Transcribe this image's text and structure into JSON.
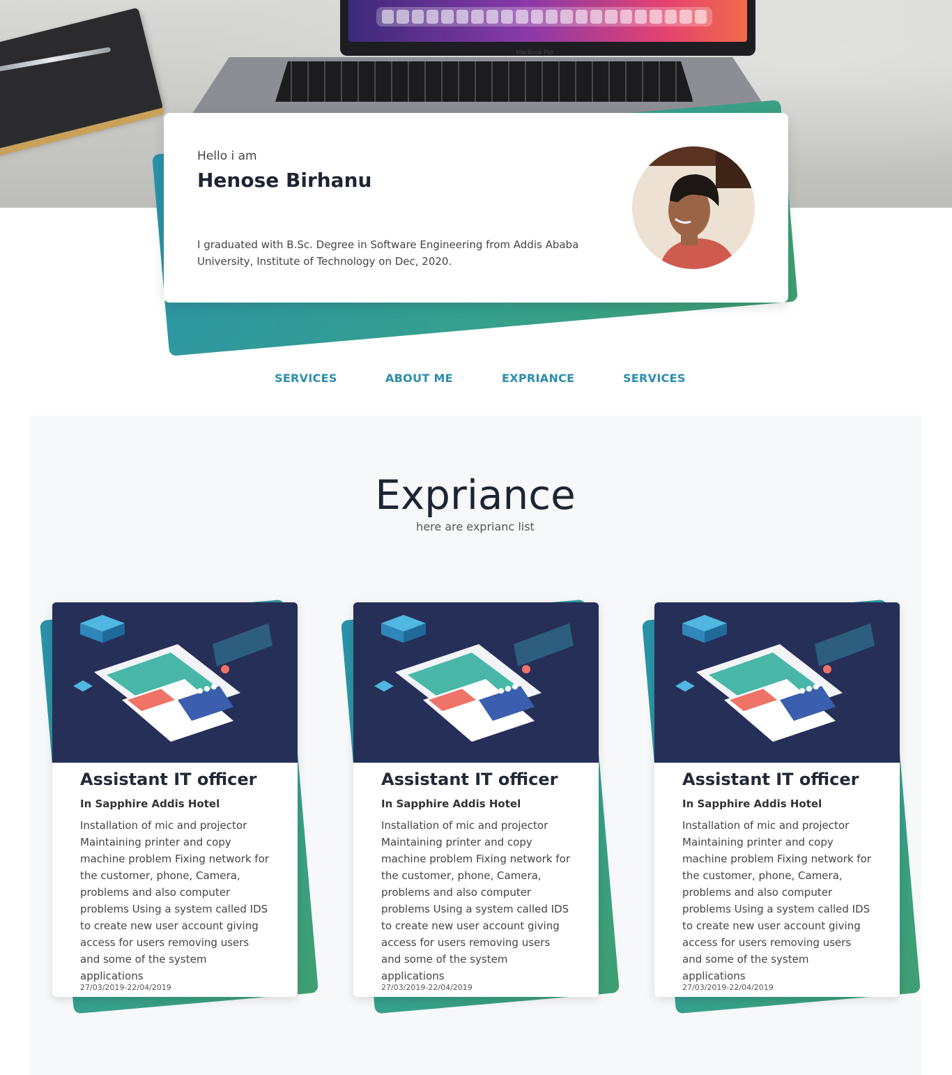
{
  "profile": {
    "greeting": "Hello i am",
    "name": "Henose Birhanu",
    "bio": "I graduated with B.Sc. Degree in Software Engineering from Addis Ababa University, Institute of Technology on Dec, 2020."
  },
  "hero": {
    "laptop_brand": "MacBook Pro"
  },
  "nav": {
    "items": [
      {
        "label": "SERVICES"
      },
      {
        "label": "ABOUT ME"
      },
      {
        "label": "EXPRIANCE"
      },
      {
        "label": "SERVICES"
      }
    ]
  },
  "experience": {
    "title": "Expriance",
    "subtitle": "here are exprianc list",
    "cards": [
      {
        "title": "Assistant IT officer",
        "company": "In Sapphire Addis Hotel",
        "description": "Installation of mic and projector Maintaining printer and copy machine problem Fixing network for the customer, phone, Camera, problems and also computer problems Using a system called IDS to create new user account giving access for users removing users and some of the system applications",
        "date": "27/03/2019-22/04/2019"
      },
      {
        "title": "Assistant IT officer",
        "company": "In Sapphire Addis Hotel",
        "description": "Installation of mic and projector Maintaining printer and copy machine problem Fixing network for the customer, phone, Camera, problems and also computer problems Using a system called IDS to create new user account giving access for users removing users and some of the system applications",
        "date": "27/03/2019-22/04/2019"
      },
      {
        "title": "Assistant IT officer",
        "company": "In Sapphire Addis Hotel",
        "description": "Installation of mic and projector Maintaining printer and copy machine problem Fixing network for the customer, phone, Camera, problems and also computer problems Using a system called IDS to create new user account giving access for users removing users and some of the system applications",
        "date": "27/03/2019-22/04/2019"
      }
    ]
  },
  "colors": {
    "accent": "#2a8dae",
    "card_back_start": "#2a91a9",
    "card_back_end": "#3f9f72",
    "heading": "#1d2433"
  }
}
